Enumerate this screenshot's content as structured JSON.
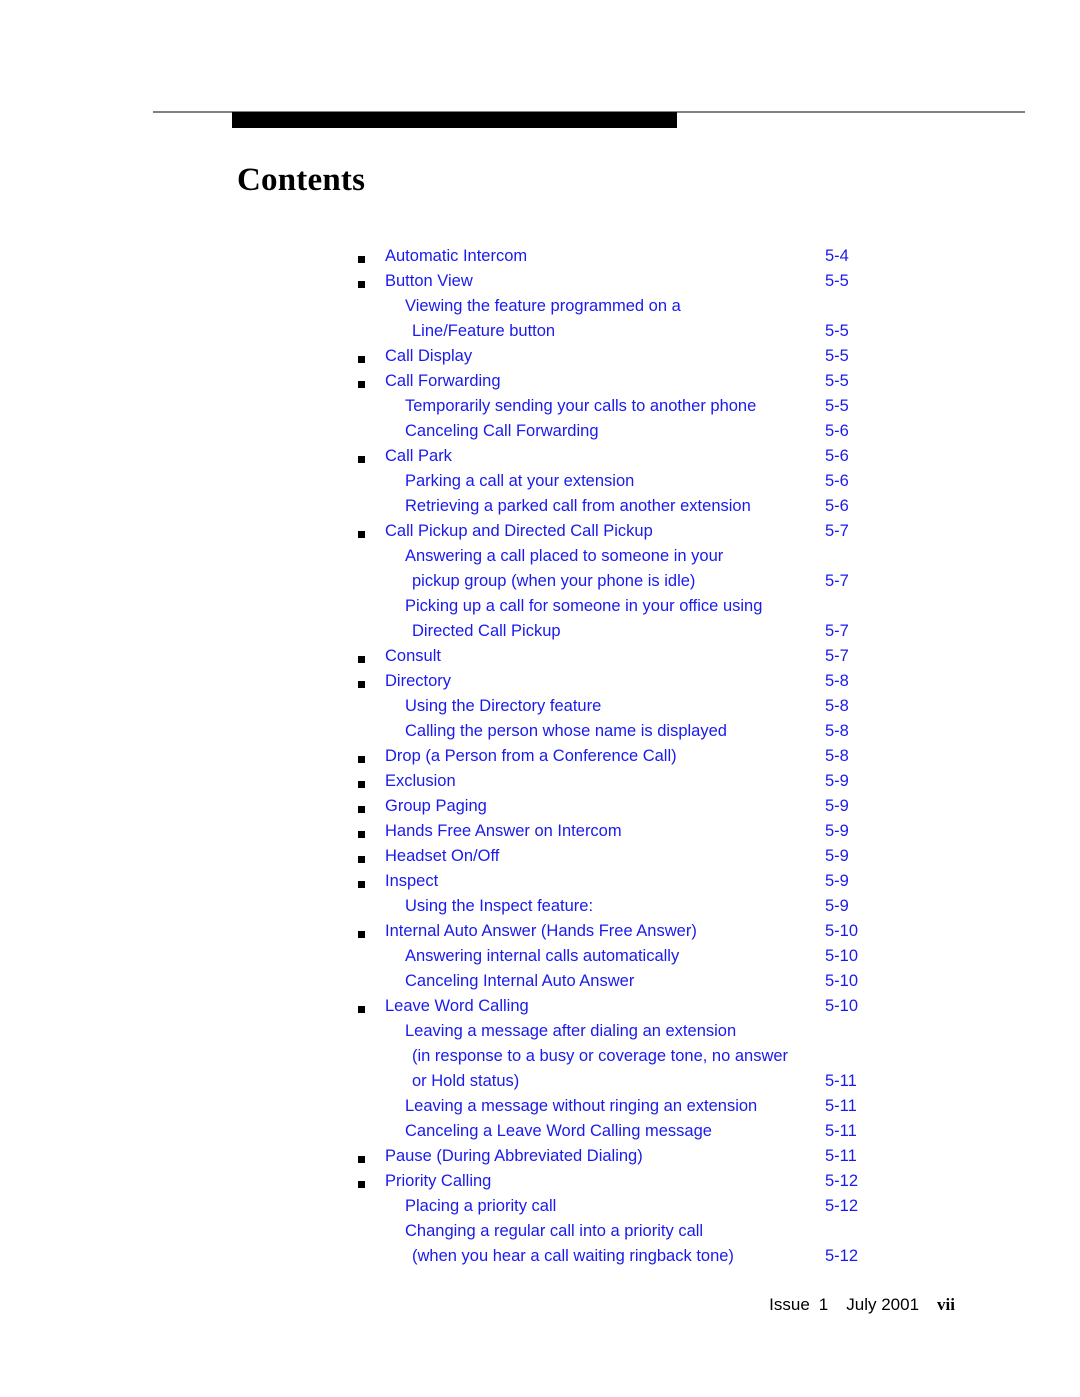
{
  "document": {
    "title": "Contents",
    "accent_color": "#1a1aec",
    "rule_color": "#808080",
    "bar_color": "#000000"
  },
  "footer": {
    "issue_label": "Issue",
    "issue_number": "1",
    "date": "July 2001",
    "folio": "vii"
  },
  "toc": {
    "entries": [
      {
        "level": 1,
        "lines": [
          "Automatic Intercom"
        ],
        "page": "5-4"
      },
      {
        "level": 1,
        "lines": [
          "Button View"
        ],
        "page": "5-5"
      },
      {
        "level": 2,
        "lines": [
          "Viewing the feature programmed on a",
          "Line/Feature button"
        ],
        "page": "5-5"
      },
      {
        "level": 1,
        "lines": [
          "Call Display"
        ],
        "page": "5-5"
      },
      {
        "level": 1,
        "lines": [
          "Call Forwarding"
        ],
        "page": "5-5"
      },
      {
        "level": 2,
        "lines": [
          "Temporarily sending your calls to another phone"
        ],
        "page": "5-5"
      },
      {
        "level": 2,
        "lines": [
          "Canceling Call Forwarding"
        ],
        "page": "5-6"
      },
      {
        "level": 1,
        "lines": [
          "Call Park"
        ],
        "page": "5-6"
      },
      {
        "level": 2,
        "lines": [
          "Parking a call at your extension"
        ],
        "page": "5-6"
      },
      {
        "level": 2,
        "lines": [
          "Retrieving a parked call from another extension"
        ],
        "page": "5-6"
      },
      {
        "level": 1,
        "lines": [
          "Call Pickup and Directed Call Pickup"
        ],
        "page": "5-7"
      },
      {
        "level": 2,
        "lines": [
          "Answering a call placed to someone in your",
          "pickup group (when your phone is idle)"
        ],
        "page": "5-7"
      },
      {
        "level": 2,
        "lines": [
          "Picking up a call for someone in your office using",
          "Directed Call Pickup"
        ],
        "page": "5-7"
      },
      {
        "level": 1,
        "lines": [
          "Consult"
        ],
        "page": "5-7"
      },
      {
        "level": 1,
        "lines": [
          "Directory"
        ],
        "page": "5-8"
      },
      {
        "level": 2,
        "lines": [
          "Using the Directory feature"
        ],
        "page": "5-8"
      },
      {
        "level": 2,
        "lines": [
          "Calling the person whose name is displayed"
        ],
        "page": "5-8"
      },
      {
        "level": 1,
        "lines": [
          "Drop (a Person from a Conference Call)"
        ],
        "page": "5-8"
      },
      {
        "level": 1,
        "lines": [
          "Exclusion"
        ],
        "page": "5-9"
      },
      {
        "level": 1,
        "lines": [
          "Group Paging"
        ],
        "page": "5-9"
      },
      {
        "level": 1,
        "lines": [
          "Hands Free Answer on Intercom"
        ],
        "page": "5-9"
      },
      {
        "level": 1,
        "lines": [
          "Headset On/Off"
        ],
        "page": "5-9"
      },
      {
        "level": 1,
        "lines": [
          "Inspect"
        ],
        "page": "5-9"
      },
      {
        "level": 2,
        "lines": [
          "Using the Inspect feature:"
        ],
        "page": "5-9"
      },
      {
        "level": 1,
        "lines": [
          "Internal Auto Answer (Hands Free Answer)"
        ],
        "page": "5-10"
      },
      {
        "level": 2,
        "lines": [
          "Answering internal calls automatically"
        ],
        "page": "5-10"
      },
      {
        "level": 2,
        "lines": [
          "Canceling Internal Auto Answer"
        ],
        "page": "5-10"
      },
      {
        "level": 1,
        "lines": [
          "Leave Word Calling"
        ],
        "page": "5-10"
      },
      {
        "level": 2,
        "lines": [
          "Leaving a message after dialing an extension",
          "(in response to a busy or coverage tone, no answer",
          "or Hold status)"
        ],
        "page": "5-11"
      },
      {
        "level": 2,
        "lines": [
          "Leaving a message without ringing an extension"
        ],
        "page": "5-11"
      },
      {
        "level": 2,
        "lines": [
          "Canceling a Leave Word Calling message"
        ],
        "page": "5-11"
      },
      {
        "level": 1,
        "lines": [
          "Pause (During Abbreviated Dialing)"
        ],
        "page": "5-11"
      },
      {
        "level": 1,
        "lines": [
          "Priority Calling"
        ],
        "page": "5-12"
      },
      {
        "level": 2,
        "lines": [
          "Placing a priority call"
        ],
        "page": "5-12"
      },
      {
        "level": 2,
        "lines": [
          "Changing a regular call into a priority call",
          "(when you hear a call waiting ringback tone)"
        ],
        "page": "5-12"
      }
    ]
  }
}
